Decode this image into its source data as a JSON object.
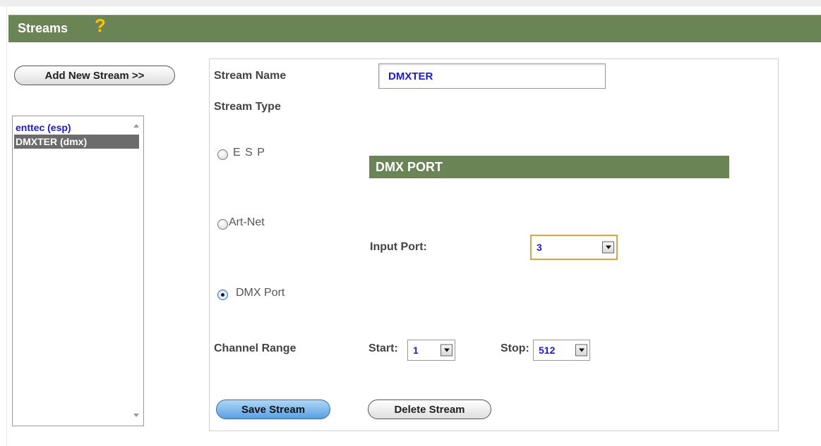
{
  "header": {
    "title": "Streams",
    "help_icon": "?"
  },
  "add_button_label": "Add New Stream >>",
  "stream_list": {
    "items": [
      {
        "label": "enttec (esp)",
        "selected": false
      },
      {
        "label": "DMXTER (dmx)",
        "selected": true
      }
    ]
  },
  "form": {
    "stream_name_label": "Stream Name",
    "stream_name_value": "DMXTER",
    "stream_type_label": "Stream Type",
    "radio_esp_label": "E S P",
    "radio_artnet_label": "Art-Net",
    "radio_dmx_label": "DMX Port",
    "selected_type": "DMX Port",
    "section_title": "DMX PORT",
    "input_port_label": "Input Port:",
    "input_port_value": "3",
    "channel_range_label": "Channel Range",
    "start_label": "Start:",
    "start_value": "1",
    "stop_label": "Stop:",
    "stop_value": "512",
    "save_button_label": "Save Stream",
    "delete_button_label": "Delete Stream"
  },
  "colors": {
    "header_green": "#6a8455",
    "help_yellow": "#f2c21b",
    "link_blue": "#1a1ad6",
    "selection_gray": "#6c6c6c",
    "focus_orange": "#e0a43b"
  }
}
